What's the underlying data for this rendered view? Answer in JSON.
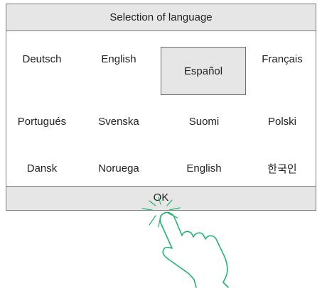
{
  "dialog": {
    "title": "Selection of language",
    "ok_label": "OK",
    "selected_language": "Español",
    "accent_color": "#1fb56f",
    "languages": [
      [
        "Deutsch",
        "English",
        "Español",
        "Français"
      ],
      [
        "Portugués",
        "Svenska",
        "Suomi",
        "Polski"
      ],
      [
        "Dansk",
        "Noruega",
        "English",
        "한국인"
      ]
    ]
  }
}
